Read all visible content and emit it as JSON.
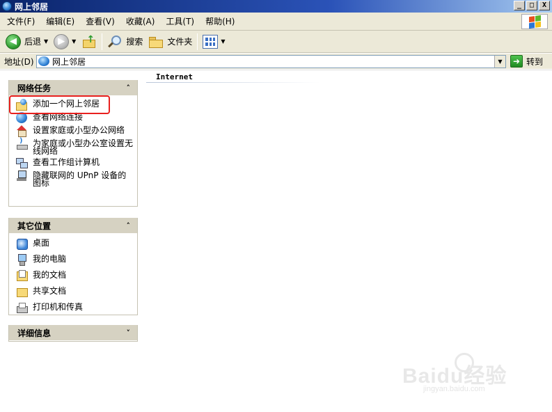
{
  "window": {
    "title": "网上邻居",
    "buttons": {
      "minimize": "_",
      "maximize": "□",
      "close": "X"
    }
  },
  "menubar": {
    "items": [
      "文件(F)",
      "编辑(E)",
      "查看(V)",
      "收藏(A)",
      "工具(T)",
      "帮助(H)"
    ]
  },
  "toolbar": {
    "back_label": "后退",
    "search_label": "搜索",
    "folders_label": "文件夹",
    "dropdown_glyph": "▼"
  },
  "address": {
    "label": "地址(D)",
    "value": "网上邻居",
    "go_label": "转到"
  },
  "panels": {
    "network_tasks": {
      "title": "网络任务",
      "items": [
        {
          "label": "添加一个网上邻居",
          "icon": "add-network-place-icon"
        },
        {
          "label": "查看网络连接",
          "icon": "network-connections-icon"
        },
        {
          "label": "设置家庭或小型办公网络",
          "icon": "home-network-icon"
        },
        {
          "label": "为家庭或小型办公室设置无线网络",
          "icon": "wireless-network-icon"
        },
        {
          "label": "查看工作组计算机",
          "icon": "workgroup-computers-icon"
        },
        {
          "label": "隐藏联网的 UPnP 设备的图标",
          "icon": "upnp-device-icon"
        }
      ]
    },
    "other_places": {
      "title": "其它位置",
      "items": [
        {
          "label": "桌面",
          "icon": "desktop-icon"
        },
        {
          "label": "我的电脑",
          "icon": "my-computer-icon"
        },
        {
          "label": "我的文档",
          "icon": "my-documents-icon"
        },
        {
          "label": "共享文档",
          "icon": "shared-documents-icon"
        },
        {
          "label": "打印机和传真",
          "icon": "printers-faxes-icon"
        }
      ]
    },
    "details": {
      "title": "详细信息"
    }
  },
  "main": {
    "group_header": "Internet"
  },
  "watermark": {
    "text": "Baidu经验",
    "subtext": "jingyan.baidu.com"
  },
  "colors": {
    "titlebar": "#0a246a",
    "chrome": "#ece9d8",
    "panel_header": "#d6d2c2",
    "highlight": "#e8201e"
  }
}
